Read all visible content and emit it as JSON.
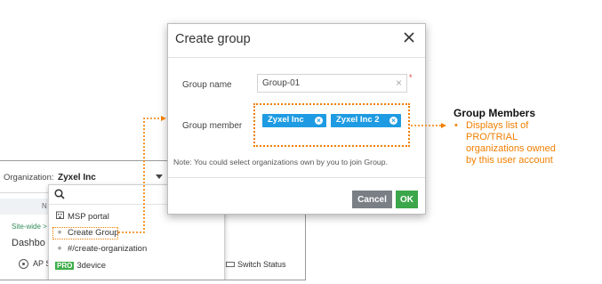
{
  "background": {
    "organization_label": "Organization:",
    "organization_value": "Zyxel Inc",
    "strip_text": "N",
    "site_text": "Site-wide >",
    "dashboard_text": "Dashbo",
    "ap_text": "AP S",
    "switch_text": "Switch Status"
  },
  "dropdown": {
    "items": [
      {
        "icon": "building-icon",
        "label": "MSP portal"
      },
      {
        "icon": "plus-icon",
        "label": "Create Group"
      },
      {
        "icon": "plus-icon",
        "label": "#/create-organization"
      },
      {
        "badge": "PRO",
        "label": "3device"
      }
    ]
  },
  "modal": {
    "title": "Create group",
    "group_name_label": "Group name",
    "group_name_value": "Group-01",
    "required_mark": "*",
    "group_member_label": "Group member",
    "members": [
      "Zyxel Inc",
      "Zyxel Inc 2"
    ],
    "note": "Note: You could select organizations own by you to join Group.",
    "cancel_label": "Cancel",
    "ok_label": "OK"
  },
  "callout": {
    "title": "Group Members",
    "bullet": "•",
    "lines": [
      "Displays list of",
      "PRO/TRIAL",
      "organizations owned",
      "by this user account"
    ]
  },
  "colors": {
    "accent_orange": "#f07f00",
    "tag_blue": "#1e9be2",
    "ok_green": "#3ba74a",
    "cancel_grey": "#7a7f85"
  }
}
